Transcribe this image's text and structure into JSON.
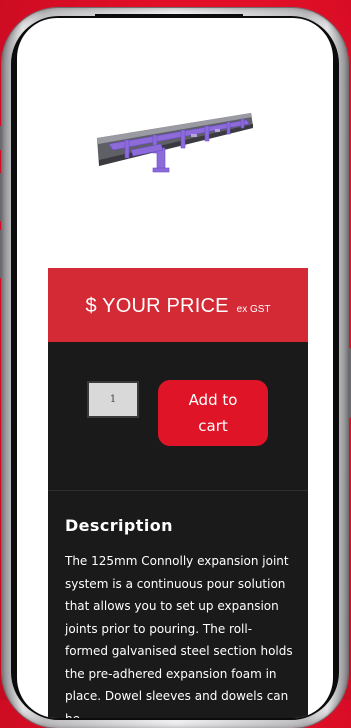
{
  "product": {
    "image_name": "expansion-joint-product-image",
    "price_label": "$ YOUR PRICE",
    "price_suffix": "ex GST",
    "quantity_value": "1",
    "add_to_cart_label": "Add to cart"
  },
  "description": {
    "title": "Description",
    "body": "The 125mm Connolly expansion joint system is a continuous pour solution that allows you to set up expansion joints prior to pouring. The roll-formed galvanised steel section holds the pre-adhered expansion foam in place. Dowel sleeves and dowels can be"
  },
  "colors": {
    "background_red": "#e40f28",
    "price_bar": "#d42a35",
    "card_dark": "#1a1a1b",
    "button_red": "#e01427"
  }
}
